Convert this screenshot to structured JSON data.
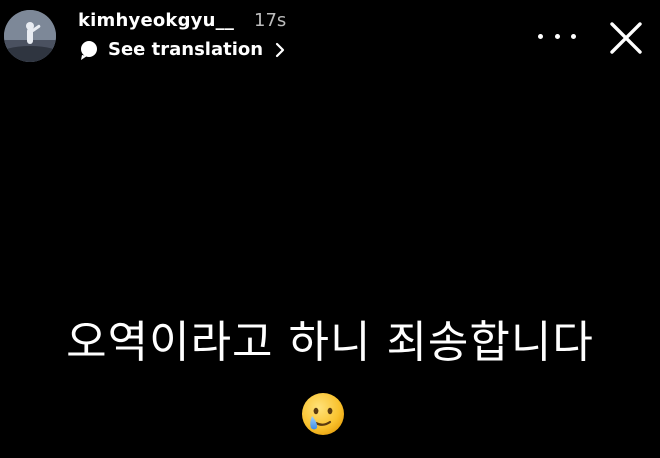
{
  "header": {
    "username": "kimhyeokgyu__",
    "time": "17s",
    "translation_label": "See translation"
  },
  "story": {
    "message": "오역이라고 하니 죄송합니다",
    "emoji": "crying-smiley-face"
  },
  "icons": {
    "avatar": "profile-avatar",
    "translation": "speech-bubble-icon",
    "chevron": "chevron-right-icon",
    "more": "more-horizontal-icon",
    "close": "close-icon"
  },
  "colors": {
    "background": "#000000",
    "text": "#ffffff",
    "muted_text": "#bdbdbd"
  }
}
